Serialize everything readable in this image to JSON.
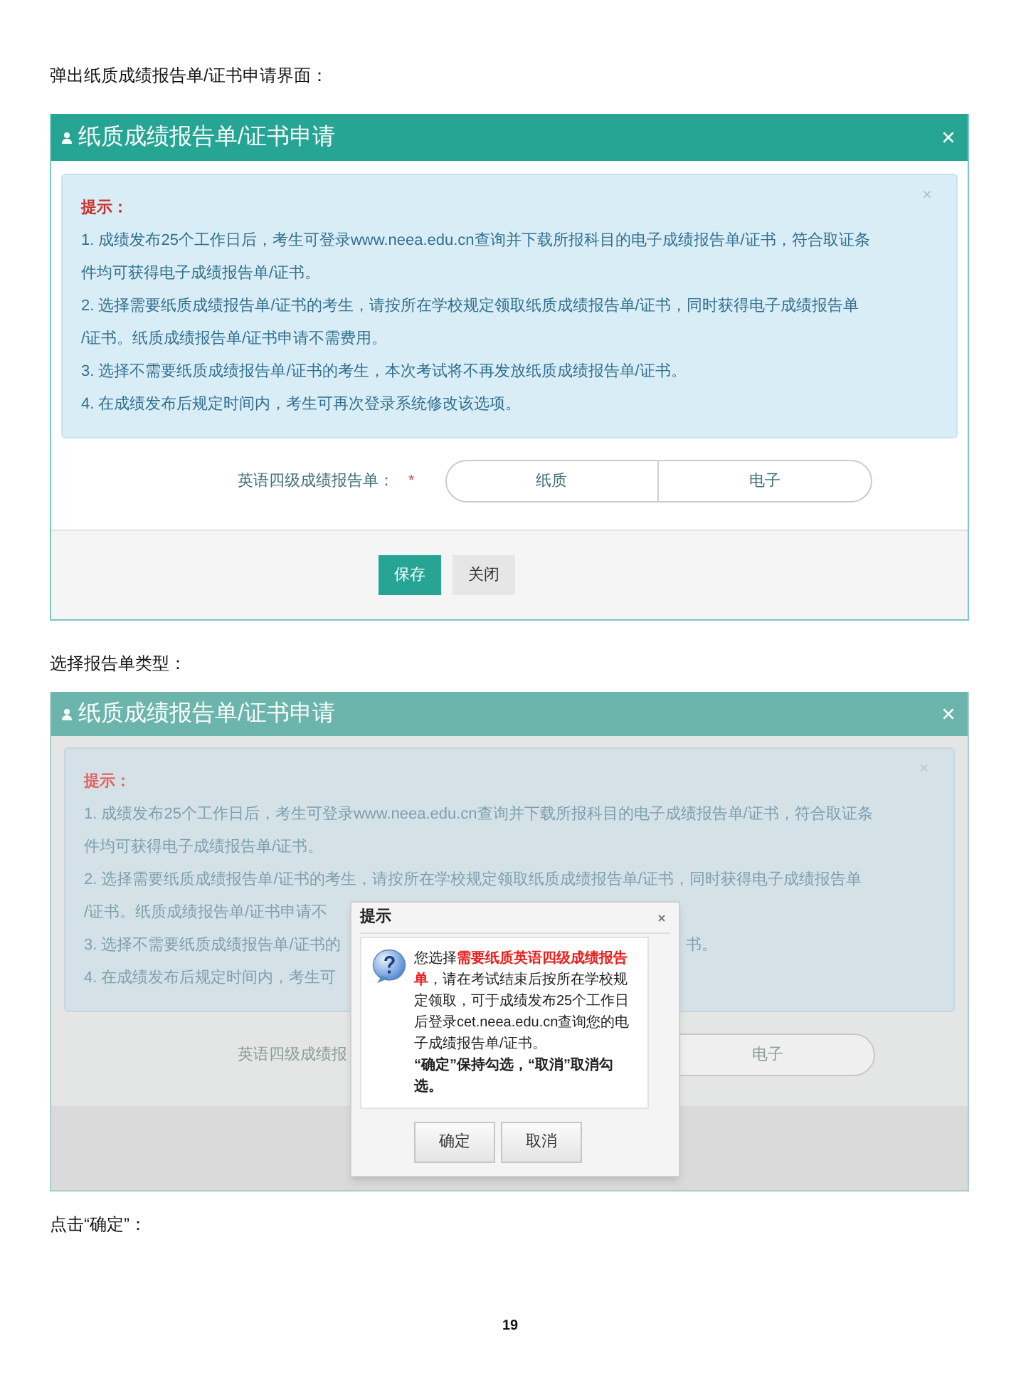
{
  "caption_1": "弹出纸质成绩报告单/证书申请界面：",
  "dialog_1": {
    "title": "纸质成绩报告单/证书申请",
    "dimmed": false,
    "notice": {
      "heading": "提示：",
      "lines": [
        {
          "text": "1. 成绩发布25个工作日后，考生可登录www.neea.edu.cn查询并下载所报科目的电子成绩报告单/证书，符合取证条"
        },
        {
          "text": "件均可获得电子成绩报告单/证书。"
        },
        {
          "text": "2. 选择需要纸质成绩报告单/证书的考生，请按所在学校规定领取纸质成绩报告单/证书，同时获得电子成绩报告单"
        },
        {
          "text": "/证书。纸质成绩报告单/证书申请不需费用。"
        },
        {
          "text": "3. 选择不需要纸质成绩报告单/证书的考生，本次考试将不再发放纸质成绩报告单/证书。"
        },
        {
          "text": "4. 在成绩发布后规定时间内，考生可再次登录系统修改该选项。"
        }
      ]
    },
    "field": {
      "label": "英语四级成绩报告单：",
      "required_mark": "*",
      "options": [
        {
          "label": "纸质",
          "selected": false
        },
        {
          "label": "电子",
          "selected": false
        }
      ]
    },
    "buttons": [
      {
        "label": "保存",
        "kind": "primary"
      },
      {
        "label": "关闭",
        "kind": "default"
      }
    ]
  },
  "caption_2": "选择报告单类型：",
  "dialog_2": {
    "title": "纸质成绩报告单/证书申请",
    "dimmed": true,
    "notice": {
      "heading": "提示：",
      "lines": [
        {
          "text": "1. 成绩发布25个工作日后，考生可登录www.neea.edu.cn查询并下载所报科目的电子成绩报告单/证书，符合取证条"
        },
        {
          "text": "件均可获得电子成绩报告单/证书。"
        },
        {
          "text": "2. 选择需要纸质成绩报告单/证书的考生，请按所在学校规定领取纸质成绩报告单/证书，同时获得电子成绩报告单"
        },
        {
          "text": "/证书。纸质成绩报告单/证书申请不"
        },
        {
          "text": "3. 选择不需要纸质成绩报告单/证书的",
          "tail": "书。"
        },
        {
          "text": "4. 在成绩发布后规定时间内，考生可"
        }
      ]
    },
    "field": {
      "label": "英语四级成绩报",
      "options": [
        {
          "label": "电子",
          "selected": false
        }
      ]
    },
    "prompt": {
      "title": "提示",
      "message": "您选择**需要纸质英语四级成绩报告单**，请在考试结束后按所在学校规定领取，可于成绩发布25个工作日后登录cet.neea.edu.cn查询您的电子成绩报告单/证书。",
      "hint": "“确定”保持勾选，“取消”取消勾选。",
      "buttons": [
        {
          "label": "确定"
        },
        {
          "label": "取消"
        }
      ]
    }
  },
  "caption_3": "点击“确定”：",
  "page_number": "19"
}
